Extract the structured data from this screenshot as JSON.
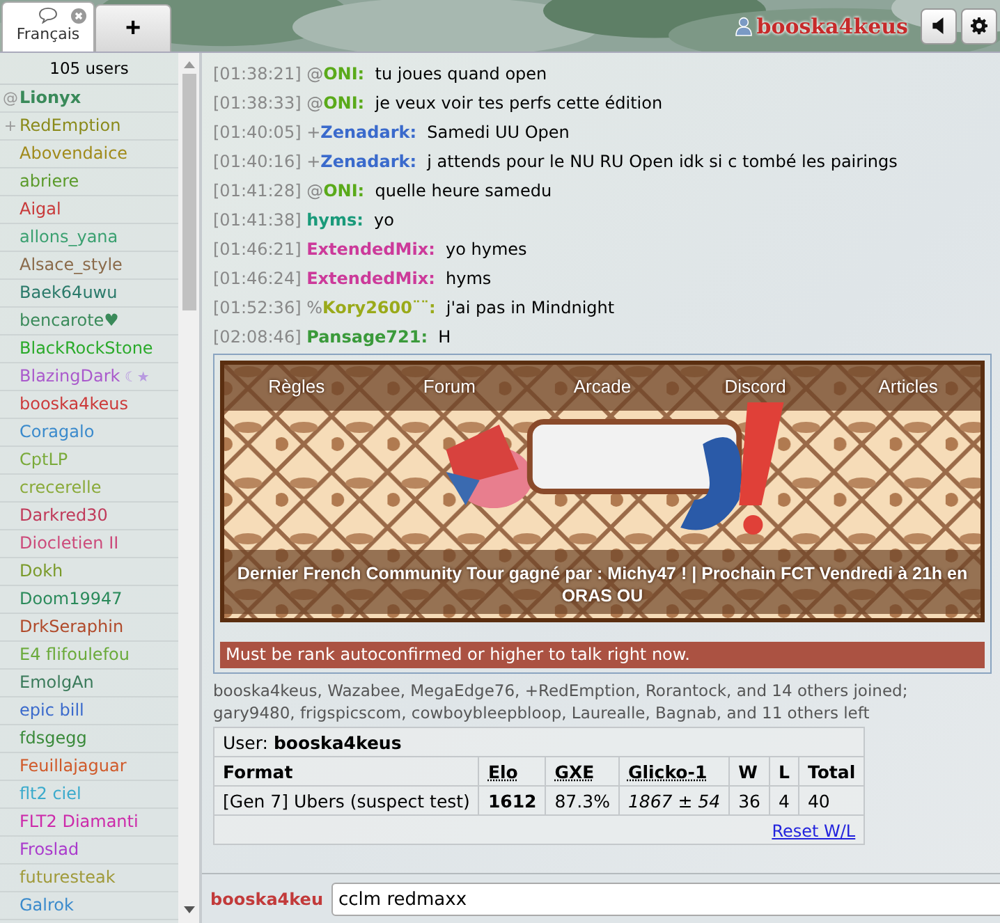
{
  "tabs": [
    {
      "label": "Français",
      "selected": true,
      "closable": true
    },
    {
      "label": "+",
      "selected": false,
      "closable": false
    }
  ],
  "account": {
    "name": "booska4keus"
  },
  "userlist": {
    "count": "105 users",
    "users": [
      {
        "rank": "@",
        "name": "Lionyx",
        "color": "#3a8a5a",
        "bold": true
      },
      {
        "rank": "+",
        "name": "RedEmption",
        "color": "#8a8a1a",
        "bold": false
      },
      {
        "name": "Abovendaice",
        "color": "#a08a1a",
        "bold": false
      },
      {
        "name": "abriere",
        "color": "#5a9a2a",
        "bold": false
      },
      {
        "name": "Aigal",
        "color": "#c83a3a",
        "bold": false
      },
      {
        "name": "allons_yana",
        "color": "#3aa070",
        "bold": false
      },
      {
        "name": "Alsace_style",
        "color": "#8a6a4a",
        "bold": false
      },
      {
        "name": "Baek64uwu",
        "color": "#2a7a6a",
        "bold": false
      },
      {
        "name": "bencarote♥",
        "color": "#3a8a5a",
        "bold": false
      },
      {
        "name": "BlackRockStone",
        "color": "#2aaa2a",
        "bold": false
      },
      {
        "name": "BlazingDark",
        "status": "☾★",
        "color": "#aa5acc",
        "bold": false
      },
      {
        "name": "booska4keus",
        "color": "#cc3a3a",
        "bold": false
      },
      {
        "name": "Coragalo",
        "color": "#3a8acc",
        "bold": false
      },
      {
        "name": "CptLP",
        "color": "#7aaa3a",
        "bold": false
      },
      {
        "name": "crecerelle",
        "color": "#8aaa3a",
        "bold": false
      },
      {
        "name": "Darkred30",
        "color": "#c03a5a",
        "bold": false
      },
      {
        "name": "Diocletien II",
        "color": "#cc4a7a",
        "bold": false
      },
      {
        "name": "Dokh",
        "color": "#7a9a2a",
        "bold": false
      },
      {
        "name": "Doom19947",
        "color": "#2a8a5a",
        "bold": false
      },
      {
        "name": "DrkSeraphin",
        "color": "#b04a2a",
        "bold": false
      },
      {
        "name": "E4 flifoulefou",
        "color": "#6aaa3a",
        "bold": false
      },
      {
        "name": "EmolgAn",
        "color": "#3a7a5a",
        "bold": false
      },
      {
        "name": "epic bill",
        "color": "#3a6acc",
        "bold": false
      },
      {
        "name": "fdsgegg",
        "color": "#3a8a3a",
        "bold": false
      },
      {
        "name": "Feuillajaguar",
        "color": "#d05a2a",
        "bold": false
      },
      {
        "name": "flt2 ciel",
        "color": "#3aaacc",
        "bold": false
      },
      {
        "name": "FLT2 Diamanti",
        "color": "#cc2aaa",
        "bold": false
      },
      {
        "name": "Froslad",
        "color": "#aa3acc",
        "bold": false
      },
      {
        "name": "futuresteak",
        "color": "#a09a3a",
        "bold": false
      },
      {
        "name": "Galrok",
        "color": "#3a8acc",
        "bold": false
      }
    ]
  },
  "messages": [
    {
      "time": "[01:38:21]",
      "rank": "@",
      "user": "ONI:",
      "color": "#5aaa1a",
      "text": "tu joues quand open"
    },
    {
      "time": "[01:38:33]",
      "rank": "@",
      "user": "ONI:",
      "color": "#5aaa1a",
      "text": "je veux voir tes perfs cette édition"
    },
    {
      "time": "[01:40:05]",
      "rank": "+",
      "user": "Zenadark:",
      "color": "#3a6acc",
      "text": "Samedi UU Open"
    },
    {
      "time": "[01:40:16]",
      "rank": "+",
      "user": "Zenadark:",
      "color": "#3a6acc",
      "text": "j attends pour le NU RU Open idk si c tombé les pairings"
    },
    {
      "time": "[01:41:28]",
      "rank": "@",
      "user": "ONI:",
      "color": "#5aaa1a",
      "text": "quelle heure samedu"
    },
    {
      "time": "[01:41:38]",
      "user": "hyms:",
      "color": "#1a9a7a",
      "text": "yo"
    },
    {
      "time": "[01:46:21]",
      "user": "ExtendedMix:",
      "color": "#cc3a9a",
      "text": "yo hymes"
    },
    {
      "time": "[01:46:24]",
      "user": "ExtendedMix:",
      "color": "#cc3a9a",
      "text": "hyms"
    },
    {
      "time": "[01:52:36]",
      "rank": "%",
      "user": "Kory2600¨¨:",
      "color": "#9aaa1a",
      "text": "j'ai pas in Mindnight"
    },
    {
      "time": "[02:08:46]",
      "user": "Pansage721:",
      "color": "#3a9a3a",
      "text": "H"
    }
  ],
  "banner": {
    "nav": [
      "Règles",
      "Forum",
      "Arcade",
      "Discord",
      "Articles"
    ],
    "caption": "Dernier French Community Tour gagné par : Michy47 ! | Prochain FCT Vendredi à 21h en ORAS OU"
  },
  "error": "Must be rank autoconfirmed or higher to talk right now.",
  "notice": "booska4keus, Wazabee, MegaEdge76, +RedEmption, Rorantock, and 14 others joined; gary9480, frigspicscom, cowboybleepbloop, Laurealle, Bagnab, and 11 others left",
  "ranking": {
    "user": "User: **booska4keus**",
    "columns": [
      "Format",
      "Elo",
      "GXE",
      "Glicko-1",
      "W",
      "L",
      "Total"
    ],
    "row": [
      "[Gen 7] Ubers (suspect test)",
      "1612",
      "87.3%",
      "1867 ± 54",
      "36",
      "4",
      "40"
    ],
    "reset": "Reset W/L"
  },
  "compose": {
    "name": "booska4keu",
    "value": "cclm redmaxx"
  }
}
